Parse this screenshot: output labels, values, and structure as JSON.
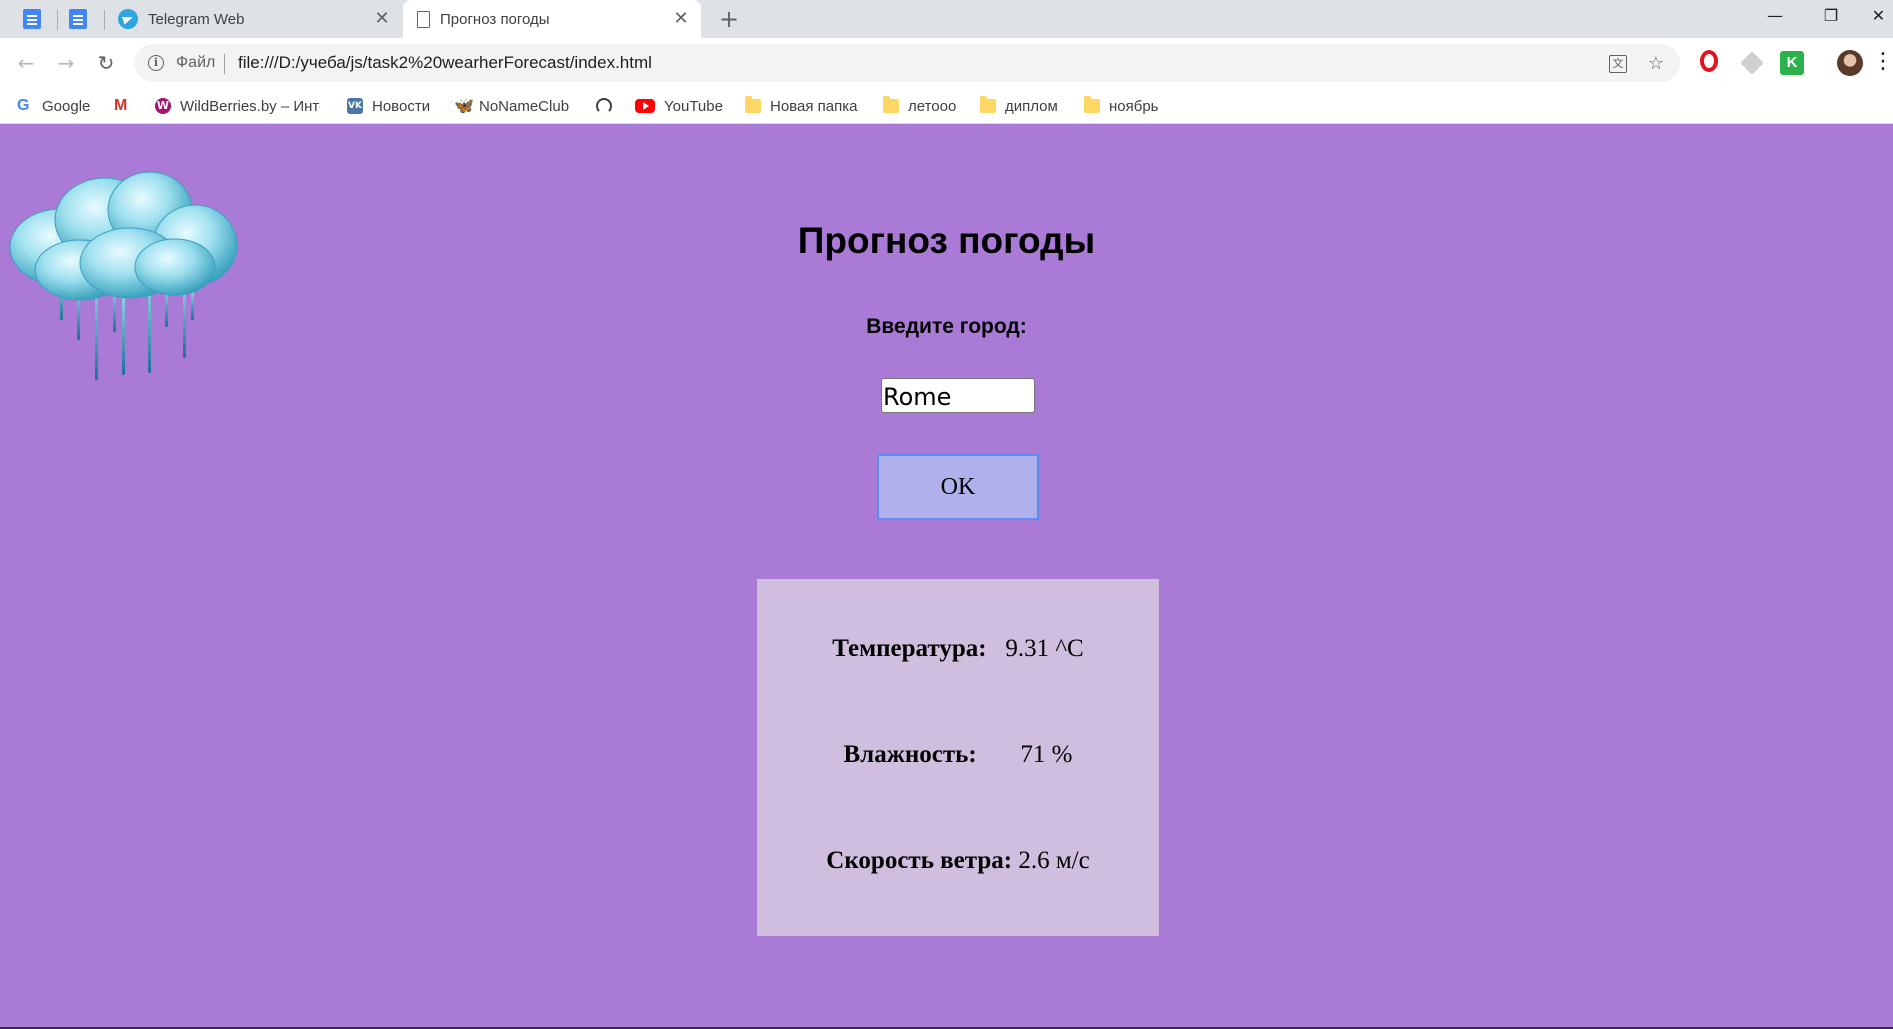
{
  "browser": {
    "tabs": [
      {
        "title": "Telegram Web",
        "icon": "telegram-icon",
        "active": false
      },
      {
        "title": "Прогноз погоды",
        "icon": "page-icon",
        "active": true
      }
    ],
    "omnibox": {
      "scheme_label": "Файл",
      "url": "file:///D:/учеба/js/task2%20wearherForecast/index.html"
    },
    "bookmarks": [
      {
        "label": "Google",
        "icon": "google-icon"
      },
      {
        "label": "",
        "icon": "gmail-icon"
      },
      {
        "label": "WildBerries.by – Инте",
        "icon": "wildberries-icon"
      },
      {
        "label": "Новости",
        "icon": "vk-icon"
      },
      {
        "label": "NoNameClub",
        "icon": "butterfly-icon"
      },
      {
        "label": "",
        "icon": "gauge-icon"
      },
      {
        "label": "YouTube",
        "icon": "youtube-icon"
      },
      {
        "label": "Новая папка",
        "icon": "folder-icon"
      },
      {
        "label": "летооо",
        "icon": "folder-icon"
      },
      {
        "label": "диплом",
        "icon": "folder-icon"
      },
      {
        "label": "ноябрь",
        "icon": "folder-icon"
      }
    ]
  },
  "page": {
    "title": "Прогноз погоды",
    "city_label": "Введите город:",
    "city_value": "Rome",
    "ok_label": "OK",
    "weather": [
      {
        "label": "Температура:",
        "value": "9.31 ^C"
      },
      {
        "label": "Влажность:",
        "value": "71 %"
      },
      {
        "label": "Скорость ветра:",
        "value": "2.6 м/с"
      }
    ]
  },
  "colors": {
    "page_background": "#a97bd6",
    "result_panel": "#cfbedd",
    "ok_button": "#b0b0ec",
    "ok_border": "#5b8ef0"
  }
}
